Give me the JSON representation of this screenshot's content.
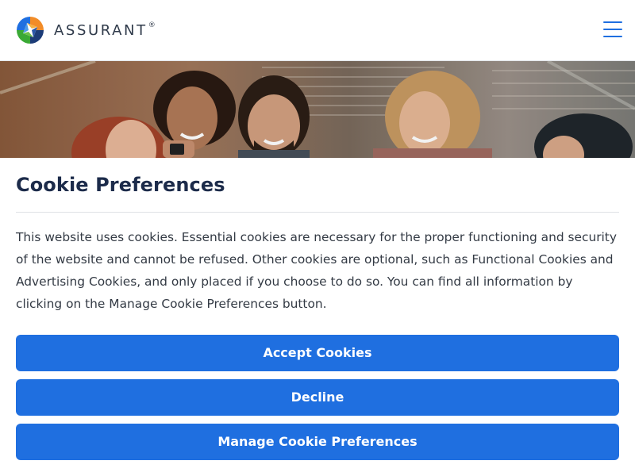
{
  "header": {
    "logo_text": "ASSURANT",
    "logo_mark": "®",
    "menu_icon": "hamburger-menu-icon",
    "brand_colors": {
      "orange": "#f28c28",
      "blue": "#1f6fe0",
      "green": "#3aa935",
      "navy": "#1c3c78"
    }
  },
  "hero": {
    "image": "group-of-friends-smiling-at-phone-photo"
  },
  "cookie_modal": {
    "title": "Cookie Preferences",
    "body": "This website uses cookies. Essential cookies are necessary for the proper functioning and security of the website and cannot be refused. Other cookies are optional, such as Functional Cookies and Advertising Cookies, and only placed if you choose to do so. You can find all information by clicking on the Manage Cookie Preferences button.",
    "accept_label": "Accept Cookies",
    "decline_label": "Decline",
    "manage_label": "Manage Cookie Preferences",
    "button_color": "#1f6fe0"
  }
}
